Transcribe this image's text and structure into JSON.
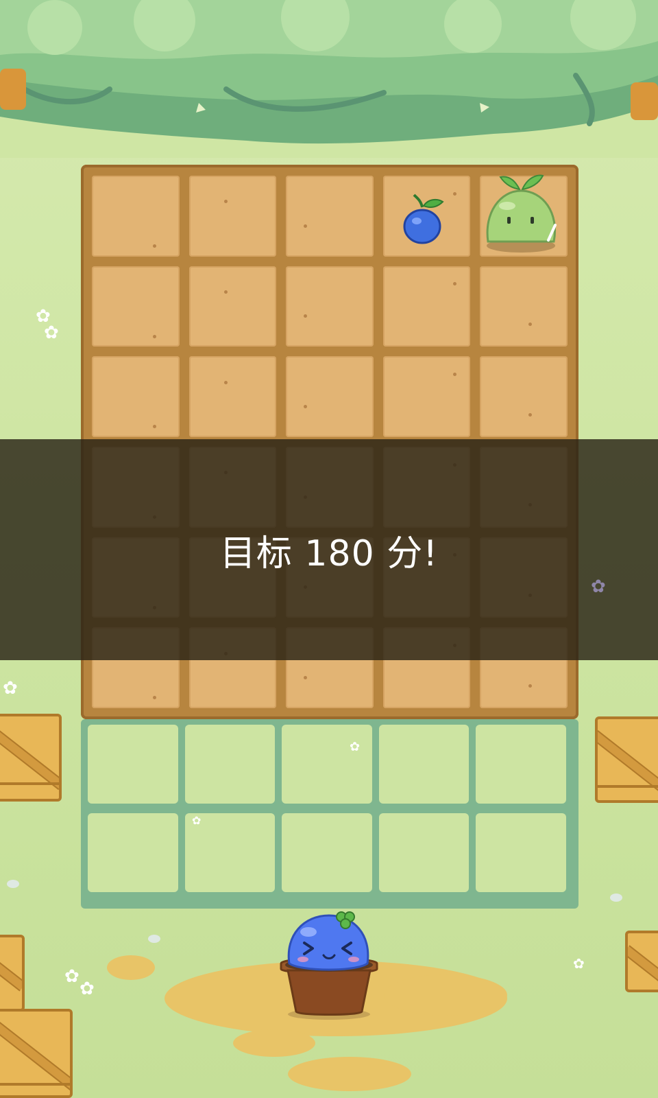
{
  "banner": {
    "text": "目标 180 分!"
  },
  "board": {
    "soil_rows": 6,
    "grass_rows": 2,
    "columns": 5
  },
  "pieces": {
    "blueberry": {
      "row": 1,
      "col": 4,
      "kind": "blueberry"
    },
    "green_slime": {
      "row": 1,
      "col": 5,
      "kind": "green-sprout-slime"
    },
    "player": {
      "kind": "blue-slime-in-pot"
    }
  },
  "colors": {
    "soil": "#e2b474",
    "board_frame": "#b7853f",
    "grass_tile": "#cde4a2",
    "grass_lines": "#7fb68f",
    "banner": "#2a2316",
    "blueberry": "#3f6fe0",
    "green_slime": "#a6d47a",
    "blue_slime": "#4f78f0"
  },
  "icons": [
    "blueberry-icon",
    "green-slime-icon",
    "blue-slime-icon",
    "flower-pot-icon",
    "crate-icon",
    "flower-icon"
  ]
}
